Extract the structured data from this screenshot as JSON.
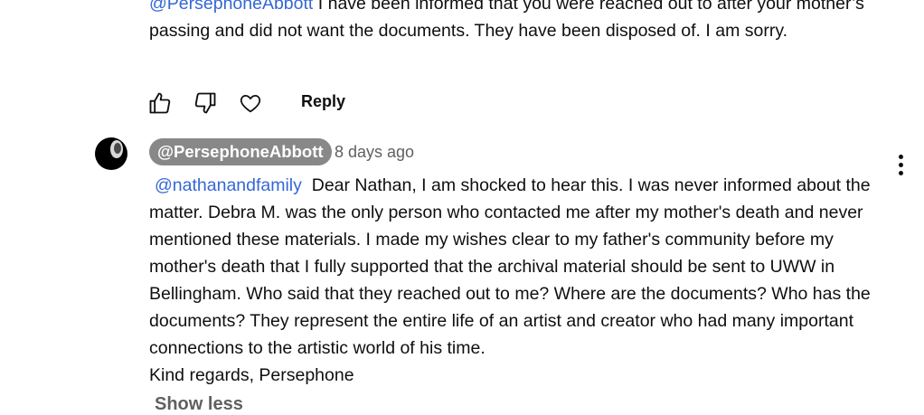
{
  "previous_comment": {
    "mention": "@PersephoneAbbott",
    "text": " I have been informed that you were reached out to after your mother’s passing and did not want the documents. They have been disposed of. I am sorry."
  },
  "actions": {
    "like_icon": "thumbs-up-icon",
    "dislike_icon": "thumbs-down-icon",
    "heart_icon": "heart-icon",
    "reply_label": "Reply"
  },
  "reply_comment": {
    "author": "@PersephoneAbbott",
    "date": "8 days ago",
    "mention": "@nathanandfamily",
    "text": "Dear Nathan, I am shocked to hear this. I was never informed about the matter. Debra M. was the only person who contacted me after my mother's death and never mentioned these materials. I made my wishes clear to my father's community before my mother's death that I fully supported that the archival material should be sent to UWW in Bellingham. Who said that they reached out to me? Where are the documents? Who has the documents? They represent the entire life of an artist and creator who had many important connections to the artistic world of his time.",
    "signoff": "Kind regards, Persephone",
    "show_less_label": "Show less",
    "more_icon": "more-vertical-icon"
  },
  "colors": {
    "mention": "#3567d6",
    "author_badge_bg": "#888888",
    "secondary_text": "#606060"
  }
}
